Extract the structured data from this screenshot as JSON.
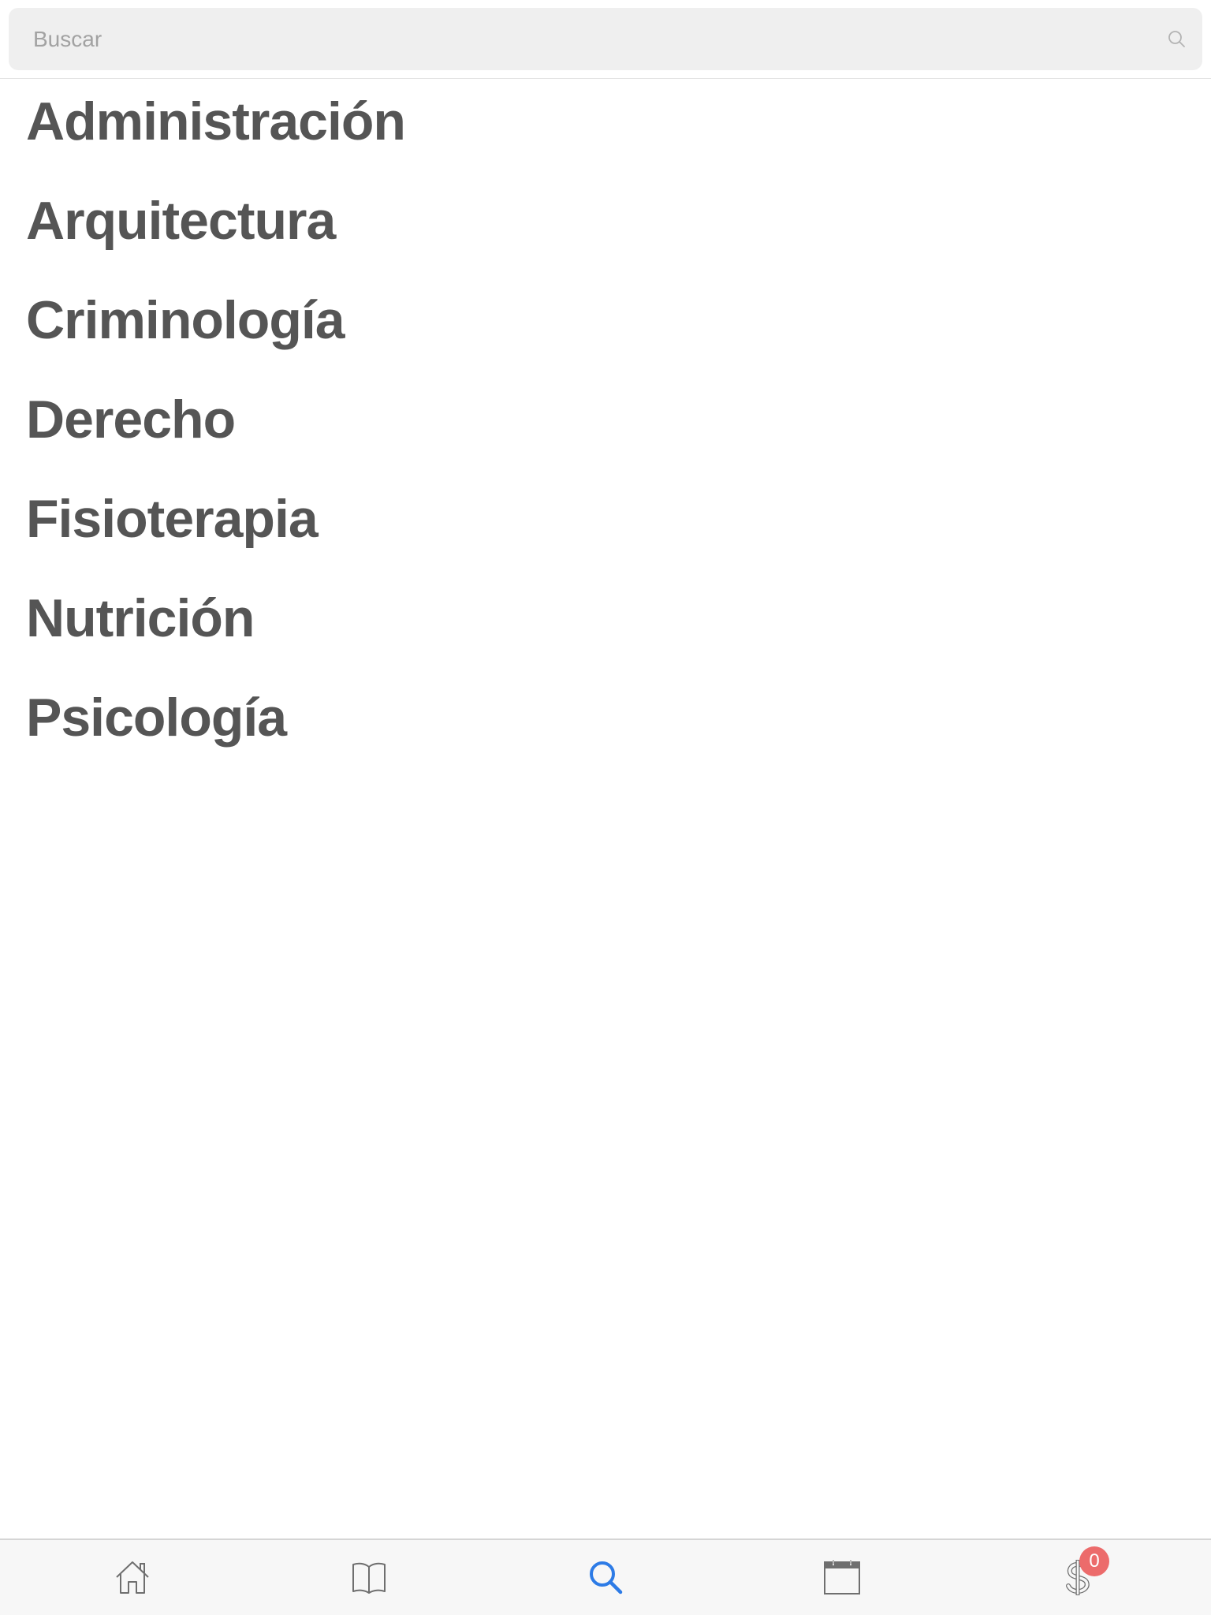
{
  "search": {
    "placeholder": "Buscar",
    "value": ""
  },
  "list": {
    "items": [
      {
        "label": "Administración"
      },
      {
        "label": "Arquitectura"
      },
      {
        "label": "Criminología"
      },
      {
        "label": "Derecho"
      },
      {
        "label": "Fisioterapia"
      },
      {
        "label": "Nutrición"
      },
      {
        "label": "Psicología"
      }
    ]
  },
  "tabbar": {
    "tabs": [
      {
        "icon": "home-icon",
        "active": false
      },
      {
        "icon": "book-icon",
        "active": false
      },
      {
        "icon": "search-icon",
        "active": true
      },
      {
        "icon": "calendar-icon",
        "active": false
      },
      {
        "icon": "dollar-icon",
        "active": false,
        "badge": "0"
      }
    ]
  },
  "colors": {
    "active_tab": "#2d7be6",
    "inactive_tab": "#6f6f6f",
    "badge": "#ec6b6b",
    "list_text": "#555555",
    "search_bg": "#efefef"
  }
}
